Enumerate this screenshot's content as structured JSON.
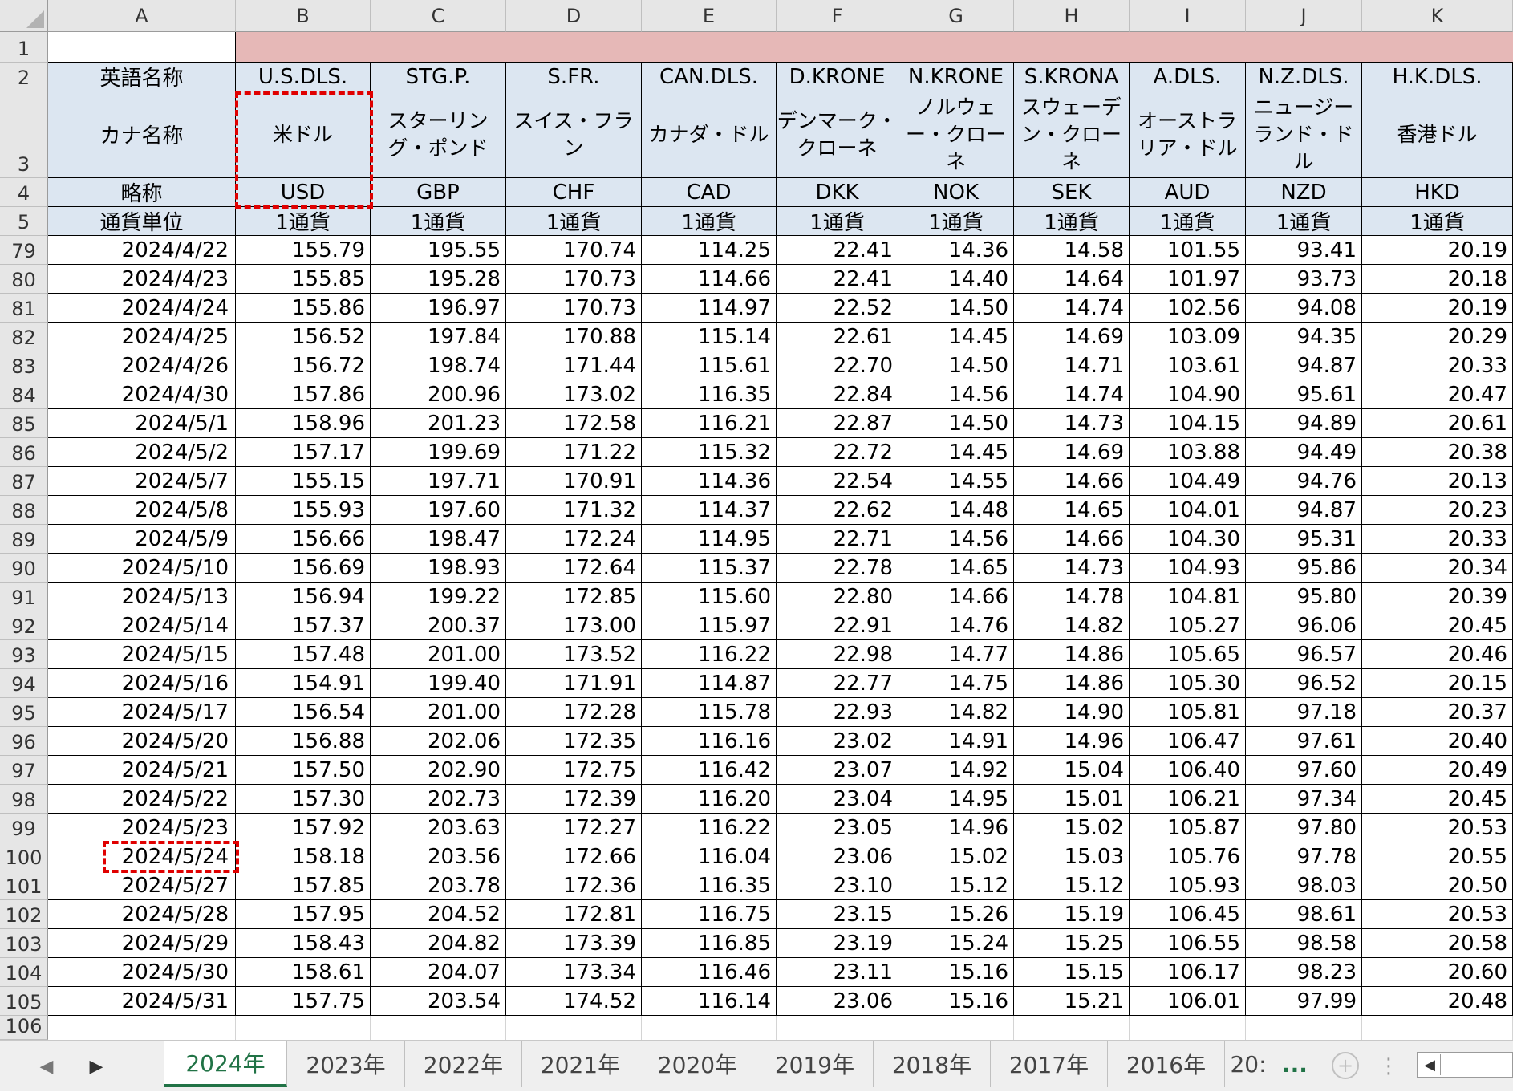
{
  "columns": [
    "A",
    "B",
    "C",
    "D",
    "E",
    "F",
    "G",
    "H",
    "I",
    "J",
    "K"
  ],
  "header_rows": {
    "row2": [
      "英語名称",
      "U.S.DLS.",
      "STG.P.",
      "S.FR.",
      "CAN.DLS.",
      "D.KRONE",
      "N.KRONE",
      "S.KRONA",
      "A.DLS.",
      "N.Z.DLS.",
      "H.K.DLS."
    ],
    "row3": [
      "カナ名称",
      "米ドル",
      "スターリング・ポンド",
      "スイス・フラン",
      "カナダ・ドル",
      "デンマーク・クローネ",
      "ノルウェー・クローネ",
      "スウェーデン・クローネ",
      "オーストラリア・ドル",
      "ニュージーランド・ドル",
      "香港ドル"
    ],
    "row4": [
      "略称",
      "USD",
      "GBP",
      "CHF",
      "CAD",
      "DKK",
      "NOK",
      "SEK",
      "AUD",
      "NZD",
      "HKD"
    ],
    "row5": [
      "通貨単位",
      "1通貨",
      "1通貨",
      "1通貨",
      "1通貨",
      "1通貨",
      "1通貨",
      "1通貨",
      "1通貨",
      "1通貨",
      "1通貨"
    ]
  },
  "data_rows": [
    {
      "row": "79",
      "date": "2024/4/22",
      "values": [
        "155.79",
        "195.55",
        "170.74",
        "114.25",
        "22.41",
        "14.36",
        "14.58",
        "101.55",
        "93.41",
        "20.19"
      ]
    },
    {
      "row": "80",
      "date": "2024/4/23",
      "values": [
        "155.85",
        "195.28",
        "170.73",
        "114.66",
        "22.41",
        "14.40",
        "14.64",
        "101.97",
        "93.73",
        "20.18"
      ]
    },
    {
      "row": "81",
      "date": "2024/4/24",
      "values": [
        "155.86",
        "196.97",
        "170.73",
        "114.97",
        "22.52",
        "14.50",
        "14.74",
        "102.56",
        "94.08",
        "20.19"
      ]
    },
    {
      "row": "82",
      "date": "2024/4/25",
      "values": [
        "156.52",
        "197.84",
        "170.88",
        "115.14",
        "22.61",
        "14.45",
        "14.69",
        "103.09",
        "94.35",
        "20.29"
      ]
    },
    {
      "row": "83",
      "date": "2024/4/26",
      "values": [
        "156.72",
        "198.74",
        "171.44",
        "115.61",
        "22.70",
        "14.50",
        "14.71",
        "103.61",
        "94.87",
        "20.33"
      ]
    },
    {
      "row": "84",
      "date": "2024/4/30",
      "values": [
        "157.86",
        "200.96",
        "173.02",
        "116.35",
        "22.84",
        "14.56",
        "14.74",
        "104.90",
        "95.61",
        "20.47"
      ]
    },
    {
      "row": "85",
      "date": "2024/5/1",
      "values": [
        "158.96",
        "201.23",
        "172.58",
        "116.21",
        "22.87",
        "14.50",
        "14.73",
        "104.15",
        "94.89",
        "20.61"
      ]
    },
    {
      "row": "86",
      "date": "2024/5/2",
      "values": [
        "157.17",
        "199.69",
        "171.22",
        "115.32",
        "22.72",
        "14.45",
        "14.69",
        "103.88",
        "94.49",
        "20.38"
      ]
    },
    {
      "row": "87",
      "date": "2024/5/7",
      "values": [
        "155.15",
        "197.71",
        "170.91",
        "114.36",
        "22.54",
        "14.55",
        "14.66",
        "104.49",
        "94.76",
        "20.13"
      ]
    },
    {
      "row": "88",
      "date": "2024/5/8",
      "values": [
        "155.93",
        "197.60",
        "171.32",
        "114.37",
        "22.62",
        "14.48",
        "14.65",
        "104.01",
        "94.87",
        "20.23"
      ]
    },
    {
      "row": "89",
      "date": "2024/5/9",
      "values": [
        "156.66",
        "198.47",
        "172.24",
        "114.95",
        "22.71",
        "14.56",
        "14.66",
        "104.30",
        "95.31",
        "20.33"
      ]
    },
    {
      "row": "90",
      "date": "2024/5/10",
      "values": [
        "156.69",
        "198.93",
        "172.64",
        "115.37",
        "22.78",
        "14.65",
        "14.73",
        "104.93",
        "95.86",
        "20.34"
      ]
    },
    {
      "row": "91",
      "date": "2024/5/13",
      "values": [
        "156.94",
        "199.22",
        "172.85",
        "115.60",
        "22.80",
        "14.66",
        "14.78",
        "104.81",
        "95.80",
        "20.39"
      ]
    },
    {
      "row": "92",
      "date": "2024/5/14",
      "values": [
        "157.37",
        "200.37",
        "173.00",
        "115.97",
        "22.91",
        "14.76",
        "14.82",
        "105.27",
        "96.06",
        "20.45"
      ]
    },
    {
      "row": "93",
      "date": "2024/5/15",
      "values": [
        "157.48",
        "201.00",
        "173.52",
        "116.22",
        "22.98",
        "14.77",
        "14.86",
        "105.65",
        "96.57",
        "20.46"
      ]
    },
    {
      "row": "94",
      "date": "2024/5/16",
      "values": [
        "154.91",
        "199.40",
        "171.91",
        "114.87",
        "22.77",
        "14.75",
        "14.86",
        "105.30",
        "96.52",
        "20.15"
      ]
    },
    {
      "row": "95",
      "date": "2024/5/17",
      "values": [
        "156.54",
        "201.00",
        "172.28",
        "115.78",
        "22.93",
        "14.82",
        "14.90",
        "105.81",
        "97.18",
        "20.37"
      ]
    },
    {
      "row": "96",
      "date": "2024/5/20",
      "values": [
        "156.88",
        "202.06",
        "172.35",
        "116.16",
        "23.02",
        "14.91",
        "14.96",
        "106.47",
        "97.61",
        "20.40"
      ]
    },
    {
      "row": "97",
      "date": "2024/5/21",
      "values": [
        "157.50",
        "202.90",
        "172.75",
        "116.42",
        "23.07",
        "14.92",
        "15.04",
        "106.40",
        "97.60",
        "20.49"
      ]
    },
    {
      "row": "98",
      "date": "2024/5/22",
      "values": [
        "157.30",
        "202.73",
        "172.39",
        "116.20",
        "23.04",
        "14.95",
        "15.01",
        "106.21",
        "97.34",
        "20.45"
      ]
    },
    {
      "row": "99",
      "date": "2024/5/23",
      "values": [
        "157.92",
        "203.63",
        "172.27",
        "116.22",
        "23.05",
        "14.96",
        "15.02",
        "105.87",
        "97.80",
        "20.53"
      ]
    },
    {
      "row": "100",
      "date": "2024/5/24",
      "values": [
        "158.18",
        "203.56",
        "172.66",
        "116.04",
        "23.06",
        "15.02",
        "15.03",
        "105.76",
        "97.78",
        "20.55"
      ]
    },
    {
      "row": "101",
      "date": "2024/5/27",
      "values": [
        "157.85",
        "203.78",
        "172.36",
        "116.35",
        "23.10",
        "15.12",
        "15.12",
        "105.93",
        "98.03",
        "20.50"
      ]
    },
    {
      "row": "102",
      "date": "2024/5/28",
      "values": [
        "157.95",
        "204.52",
        "172.81",
        "116.75",
        "23.15",
        "15.26",
        "15.19",
        "106.45",
        "98.61",
        "20.53"
      ]
    },
    {
      "row": "103",
      "date": "2024/5/29",
      "values": [
        "158.43",
        "204.82",
        "173.39",
        "116.85",
        "23.19",
        "15.24",
        "15.25",
        "106.55",
        "98.58",
        "20.58"
      ]
    },
    {
      "row": "104",
      "date": "2024/5/30",
      "values": [
        "158.61",
        "204.07",
        "173.34",
        "116.46",
        "23.11",
        "15.16",
        "15.15",
        "106.17",
        "98.23",
        "20.60"
      ]
    },
    {
      "row": "105",
      "date": "2024/5/31",
      "values": [
        "157.75",
        "203.54",
        "174.52",
        "116.14",
        "23.06",
        "15.16",
        "15.21",
        "106.01",
        "97.99",
        "20.48"
      ]
    }
  ],
  "header_row_numbers": [
    "1",
    "2",
    "3",
    "4",
    "5"
  ],
  "empty_row_number": "106",
  "sheet_tabs": [
    "2024年",
    "2023年",
    "2022年",
    "2021年",
    "2020年",
    "2019年",
    "2018年",
    "2017年",
    "2016年",
    "20:"
  ],
  "active_tab_index": 0,
  "tab_overflow": "...",
  "colors": {
    "header_fill": "#dce6f1",
    "title_bar_fill": "#e6b8b7",
    "highlight_border": "#e00000",
    "active_tab_text": "#217346"
  },
  "icons": [
    "prev-sheet-icon",
    "next-sheet-icon",
    "add-sheet-icon",
    "more-options-icon",
    "scroll-left-icon"
  ]
}
